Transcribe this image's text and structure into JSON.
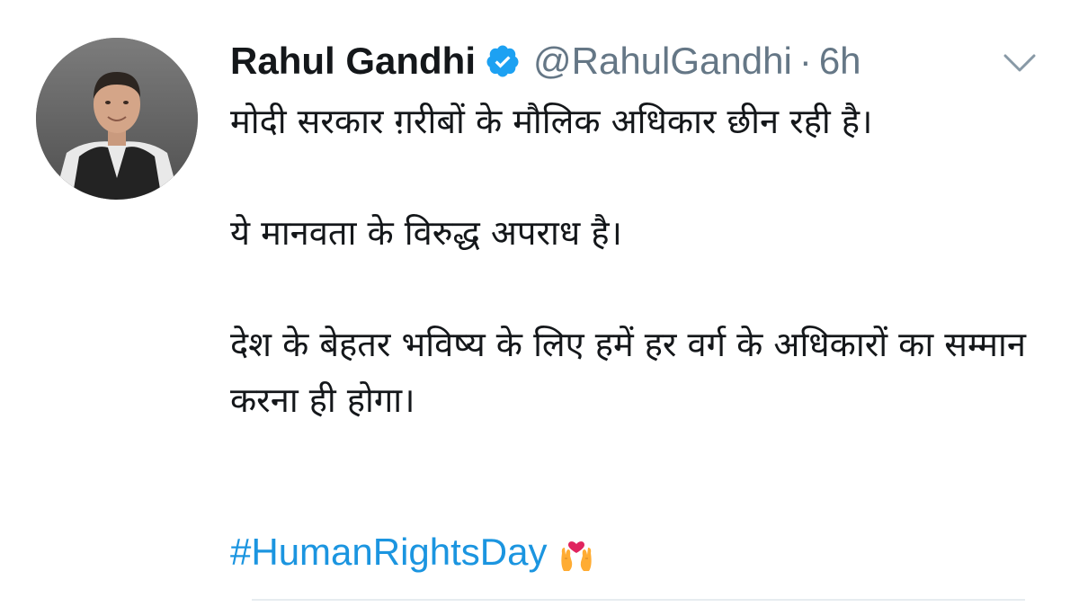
{
  "tweet": {
    "author_name": "Rahul Gandhi",
    "handle": "@RahulGandhi",
    "separator": "·",
    "timestamp": "6h",
    "verified": true,
    "paragraphs": [
      "मोदी सरकार ग़रीबों के मौलिक अधिकार छीन रही है।",
      "ये मानवता के विरुद्ध अपराध है।",
      "देश के बेहतर भविष्य के लिए हमें हर वर्ग के अधिकारों का सम्मान करना ही होगा।"
    ],
    "hashtag": "#HumanRightsDay",
    "emoji": "raised-hands-with-heart"
  },
  "icons": {
    "verified_badge": "verified-check-icon",
    "menu": "chevron-down-icon"
  },
  "colors": {
    "name": "#14171a",
    "secondary_text": "#657786",
    "hashtag": "#1b95e0",
    "verified_badge": "#1da1f2",
    "divider": "#e6ecf0"
  }
}
